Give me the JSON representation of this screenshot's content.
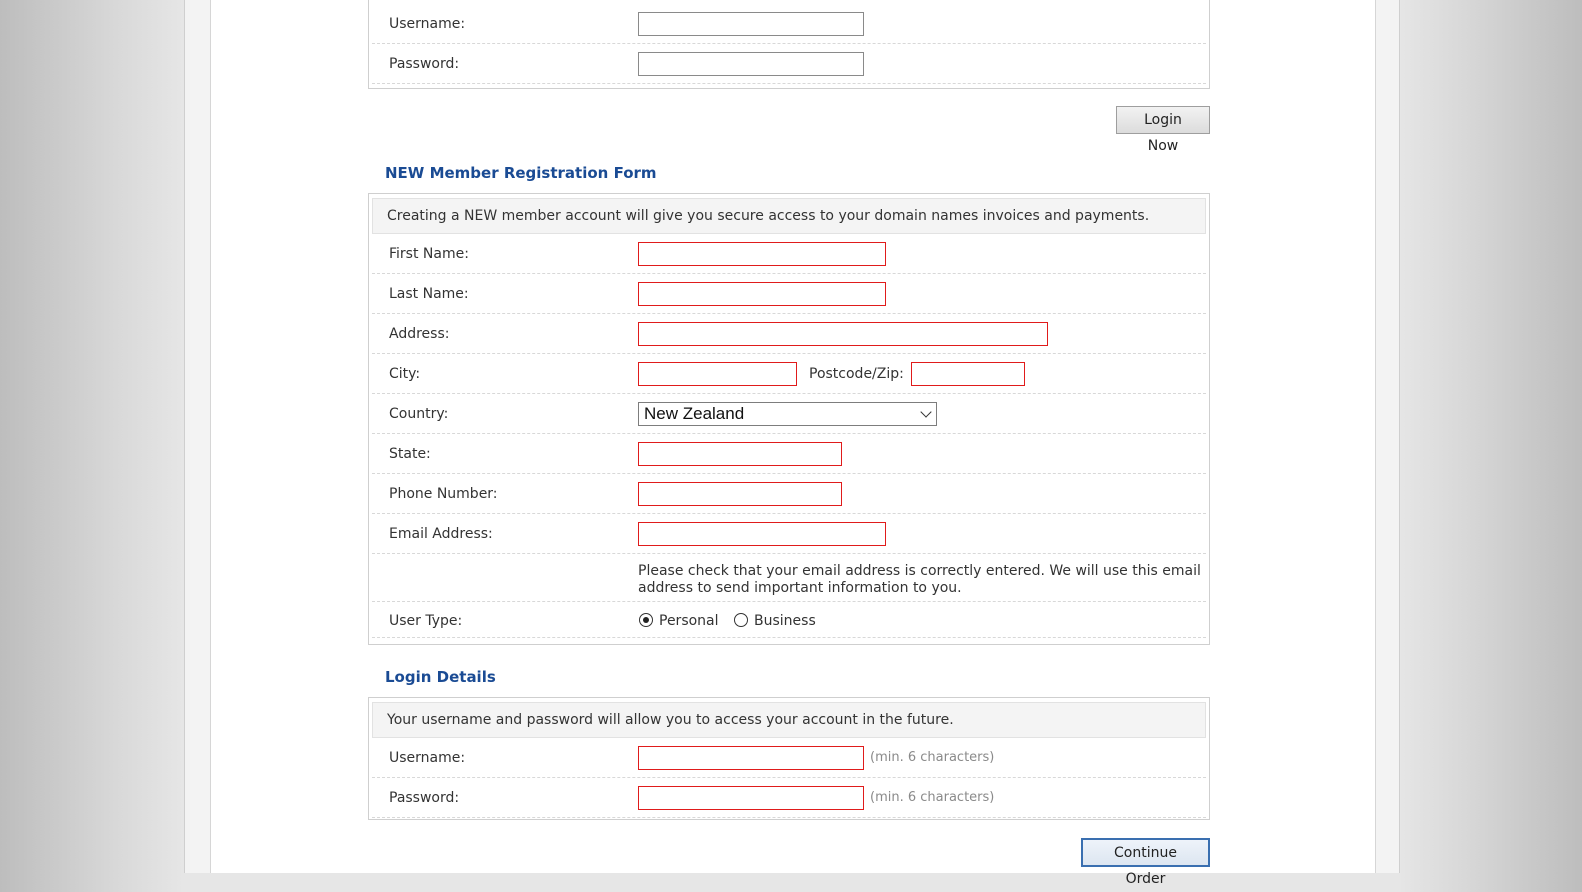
{
  "existing_login": {
    "username_label": "Username:",
    "password_label": "Password:",
    "username_value": "",
    "password_value": "",
    "login_button": "Login Now"
  },
  "registration": {
    "heading": "NEW Member Registration Form",
    "note": "Creating a NEW member account will give you secure access to your domain names invoices and payments.",
    "first_name_label": "First Name:",
    "last_name_label": "Last Name:",
    "address_label": "Address:",
    "city_label": "City:",
    "postcode_label": "Postcode/Zip:",
    "country_label": "Country:",
    "country_value": "New Zealand",
    "state_label": "State:",
    "phone_label": "Phone Number:",
    "email_label": "Email Address:",
    "email_note": "Please check that your email address is correctly entered. We will use this email address to send important information to you.",
    "user_type_label": "User Type:",
    "user_type_options": [
      "Personal",
      "Business"
    ],
    "user_type_selected": "Personal"
  },
  "login_details": {
    "heading": "Login Details",
    "note": "Your username and password will allow you to access your account in the future.",
    "username_label": "Username:",
    "password_label": "Password:",
    "username_hint": "(min. 6 characters)",
    "password_hint": "(min. 6 characters)",
    "continue_button": "Continue Order"
  },
  "colors": {
    "heading": "#1a4b94",
    "required_border": "#e01b1b",
    "primary_button_border": "#3a6fb0"
  }
}
